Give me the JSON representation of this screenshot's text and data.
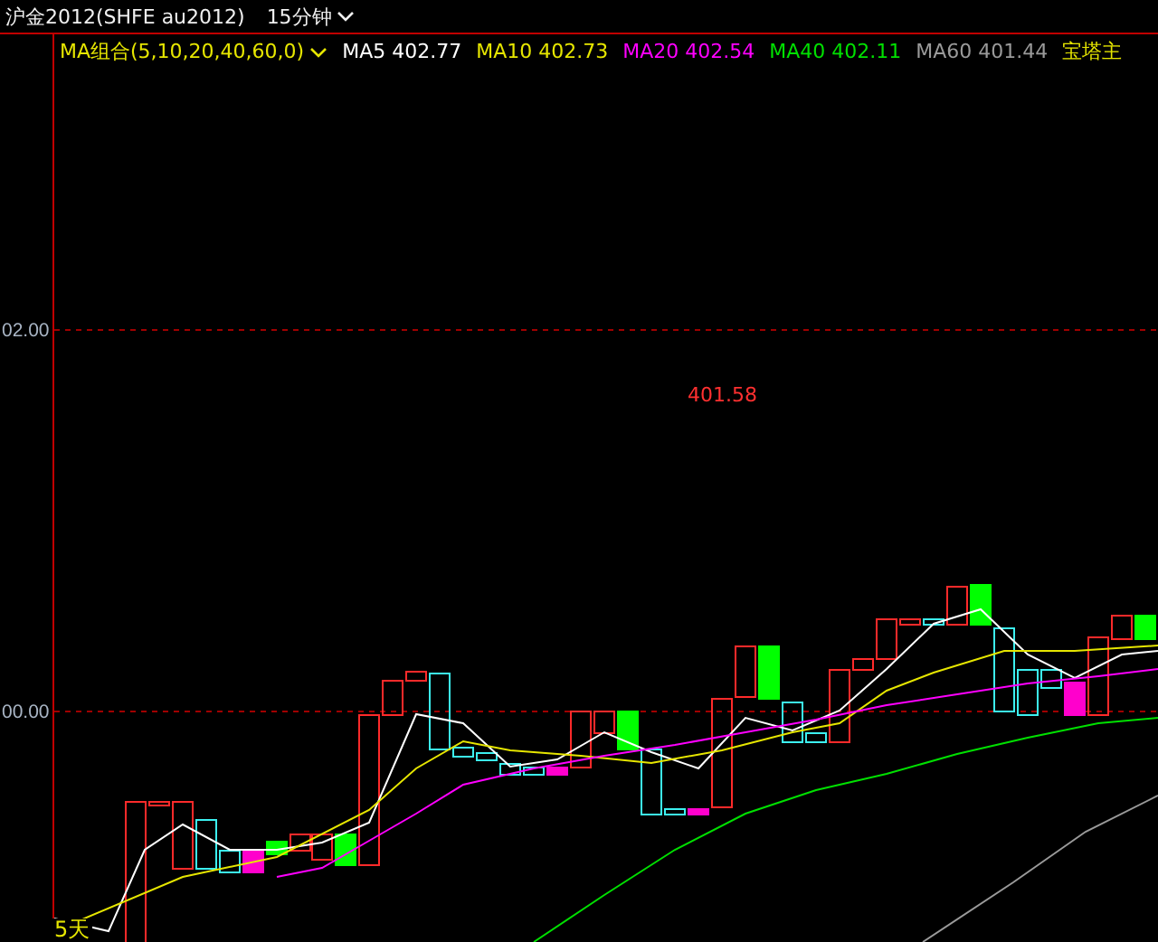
{
  "header": {
    "title": "沪金2012(SHFE au2012)",
    "period": "15分钟"
  },
  "legend": {
    "group": "MA组合(5,10,20,40,60,0)",
    "items": [
      {
        "name": "MA5",
        "value": "402.77",
        "color": "#ffffff"
      },
      {
        "name": "MA10",
        "value": "402.73",
        "color": "#e6e600"
      },
      {
        "name": "MA20",
        "value": "402.54",
        "color": "#ff00ff"
      },
      {
        "name": "MA40",
        "value": "402.11",
        "color": "#00e000"
      },
      {
        "name": "MA60",
        "value": "401.44",
        "color": "#9a9a9a"
      }
    ],
    "extra": "宝塔主"
  },
  "price_axis": {
    "labels": [
      "02.00",
      "00.00"
    ]
  },
  "annotation": "401.58",
  "period_label": "5天"
}
